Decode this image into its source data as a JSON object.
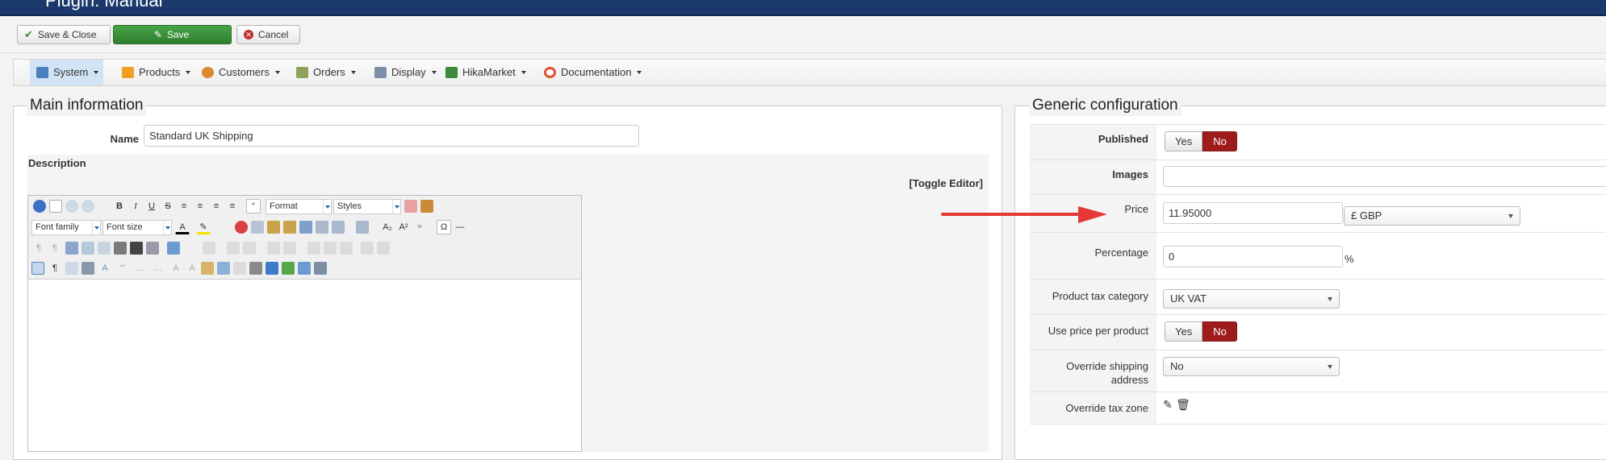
{
  "window": {
    "title": "Plugin: Manual"
  },
  "toolbar": {
    "save_close": "Save & Close",
    "save": "Save",
    "cancel": "Cancel"
  },
  "nav": {
    "items": [
      "System",
      "Products",
      "Customers",
      "Orders",
      "Display",
      "HikaMarket",
      "Documentation"
    ]
  },
  "main": {
    "legend": "Main information",
    "name_label": "Name",
    "name_value": "Standard UK Shipping",
    "description_label": "Description",
    "toggle_editor": "[Toggle Editor]",
    "editor": {
      "format_label": "Format",
      "styles_label": "Styles",
      "font_family_label": "Font family",
      "font_size_label": "Font size"
    }
  },
  "generic": {
    "legend": "Generic configuration",
    "published_label": "Published",
    "images_label": "Images",
    "price_label": "Price",
    "price_value": "11.95000",
    "currency_value": "£ GBP",
    "percentage_label": "Percentage",
    "percentage_value": "0",
    "percentage_unit": "%",
    "tax_category_label": "Product tax category",
    "tax_category_value": "UK VAT",
    "use_price_label": "Use price per product",
    "override_shipping_label_1": "Override shipping",
    "override_shipping_label_2": "address",
    "override_shipping_value": "No",
    "override_tax_label": "Override tax zone",
    "yes": "Yes",
    "no": "No"
  },
  "colors": {
    "accent_red": "#9e1c1c",
    "save_green": "#3a923a",
    "annotation_arrow": "#e53935",
    "header_navy": "#1b3a6b"
  }
}
